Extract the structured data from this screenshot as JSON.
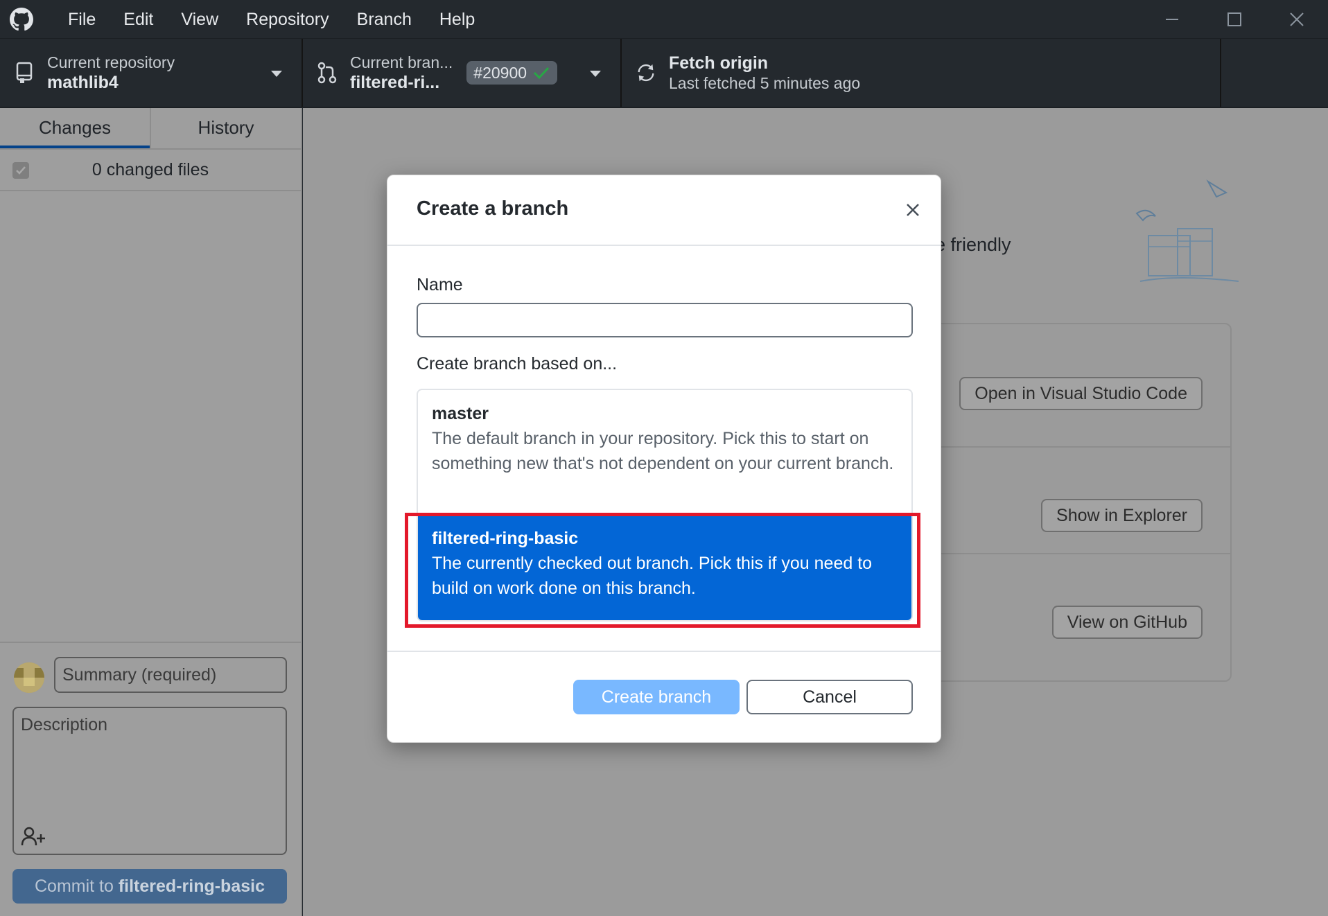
{
  "menu": [
    "File",
    "Edit",
    "View",
    "Repository",
    "Branch",
    "Help"
  ],
  "toolbar": {
    "repo_label": "Current repository",
    "repo_value": "mathlib4",
    "branch_label": "Current bran...",
    "branch_value": "filtered-ri...",
    "pr_number": "#20900",
    "fetch_label": "Fetch origin",
    "fetch_sub": "Last fetched 5 minutes ago"
  },
  "sidebar": {
    "tab_changes": "Changes",
    "tab_history": "History",
    "changed_files": "0 changed files",
    "summary_placeholder": "Summary (required)",
    "description_placeholder": "Description",
    "commit_prefix": "Commit to ",
    "commit_branch": "filtered-ring-basic"
  },
  "main": {
    "friendly_text": "e friendly",
    "open_vscode": "Open in Visual Studio Code",
    "show_explorer": "Show in Explorer",
    "view_github": "View on GitHub"
  },
  "dialog": {
    "title": "Create a branch",
    "name_label": "Name",
    "name_value": "",
    "based_on_label": "Create branch based on...",
    "branches": [
      {
        "name": "master",
        "description": "The default branch in your repository. Pick this to start on something new that's not dependent on your current branch."
      },
      {
        "name": "filtered-ring-basic",
        "description": "The currently checked out branch. Pick this if you need to build on work done on this branch."
      }
    ],
    "create_label": "Create branch",
    "cancel_label": "Cancel"
  },
  "colors": {
    "selected": "#0366d6",
    "highlight_border": "#e3192b",
    "primary_disabled": "#79b8ff"
  }
}
